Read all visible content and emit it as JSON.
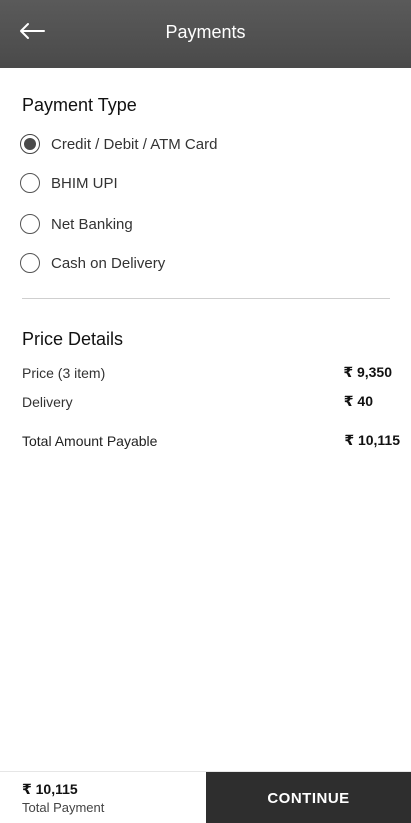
{
  "header": {
    "title": "Payments",
    "back_icon": "arrow-left-icon"
  },
  "payment": {
    "section_title": "Payment Type",
    "options": [
      {
        "label": "Credit / Debit / ATM Card",
        "selected": true
      },
      {
        "label": "BHIM UPI",
        "selected": false
      },
      {
        "label": "Net Banking",
        "selected": false
      },
      {
        "label": "Cash on Delivery",
        "selected": false
      }
    ]
  },
  "price_details": {
    "section_title": "Price Details",
    "price_label": "Price (3 item)",
    "price_value": "₹ 9,350",
    "delivery_label": "Delivery",
    "delivery_value": "₹ 40",
    "total_label": "Total Amount Payable",
    "total_value": "₹ 10,115"
  },
  "footer": {
    "total_amount": "₹ 10,115",
    "total_caption": "Total Payment",
    "continue_label": "CONTINUE"
  },
  "colors": {
    "header_bg": "#4f4f4f",
    "button_bg": "#2e2e2e",
    "radio_fill": "#4a4a4a"
  }
}
